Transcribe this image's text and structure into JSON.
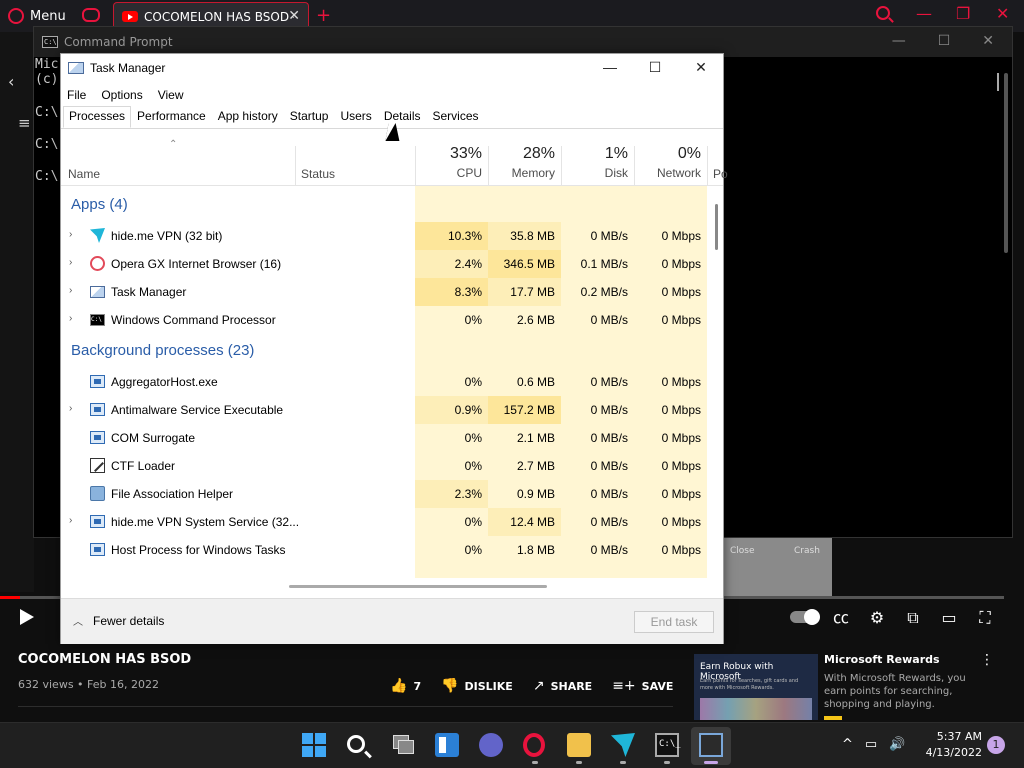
{
  "browser": {
    "menu_label": "Menu",
    "tab_title": "COCOMELON HAS BSOD -",
    "tab_close": "✕",
    "new_tab": "+",
    "minimize": "—",
    "restore": "❐",
    "close": "✕"
  },
  "cmd": {
    "title": "Command Prompt",
    "icon_text": "C:\\",
    "lines": [
      "Mic",
      "(c)",
      "C:\\",
      "C:\\",
      "C:\\"
    ],
    "minimize": "—",
    "maximize": "☐",
    "close": "✕"
  },
  "task_manager": {
    "title": "Task Manager",
    "minimize": "—",
    "maximize": "☐",
    "close": "✕",
    "menus": [
      "File",
      "Options",
      "View"
    ],
    "tabs": [
      "Processes",
      "Performance",
      "App history",
      "Startup",
      "Users",
      "Details",
      "Services"
    ],
    "active_tab": "Processes",
    "columns": {
      "name": "Name",
      "status": "Status",
      "cpu": {
        "pct": "33%",
        "label": "CPU"
      },
      "memory": {
        "pct": "28%",
        "label": "Memory"
      },
      "disk": {
        "pct": "1%",
        "label": "Disk"
      },
      "network": {
        "pct": "0%",
        "label": "Network"
      },
      "cut": "Po"
    },
    "groups": [
      {
        "label": "Apps (4)",
        "rows": [
          {
            "name": "hide.me VPN (32 bit)",
            "icon": "hideme-vpn-icon",
            "expand": true,
            "cpu": "10.3%",
            "memory": "35.8 MB",
            "disk": "0 MB/s",
            "network": "0 Mbps"
          },
          {
            "name": "Opera GX Internet Browser (16)",
            "icon": "opera-gx-icon",
            "expand": true,
            "cpu": "2.4%",
            "memory": "346.5 MB",
            "disk": "0.1 MB/s",
            "network": "0 Mbps"
          },
          {
            "name": "Task Manager",
            "icon": "task-manager-icon",
            "expand": true,
            "cpu": "8.3%",
            "memory": "17.7 MB",
            "disk": "0.2 MB/s",
            "network": "0 Mbps"
          },
          {
            "name": "Windows Command Processor",
            "icon": "cmd-icon",
            "expand": true,
            "cpu": "0%",
            "memory": "2.6 MB",
            "disk": "0 MB/s",
            "network": "0 Mbps"
          }
        ]
      },
      {
        "label": "Background processes (23)",
        "rows": [
          {
            "name": "AggregatorHost.exe",
            "icon": "service-icon",
            "expand": false,
            "cpu": "0%",
            "memory": "0.6 MB",
            "disk": "0 MB/s",
            "network": "0 Mbps"
          },
          {
            "name": "Antimalware Service Executable",
            "icon": "service-icon",
            "expand": true,
            "cpu": "0.9%",
            "memory": "157.2 MB",
            "disk": "0 MB/s",
            "network": "0 Mbps"
          },
          {
            "name": "COM Surrogate",
            "icon": "service-icon",
            "expand": false,
            "cpu": "0%",
            "memory": "2.1 MB",
            "disk": "0 MB/s",
            "network": "0 Mbps"
          },
          {
            "name": "CTF Loader",
            "icon": "ctf-loader-icon",
            "expand": false,
            "cpu": "0%",
            "memory": "2.7 MB",
            "disk": "0 MB/s",
            "network": "0 Mbps"
          },
          {
            "name": "File Association Helper",
            "icon": "file-association-icon",
            "expand": false,
            "cpu": "2.3%",
            "memory": "0.9 MB",
            "disk": "0 MB/s",
            "network": "0 Mbps"
          },
          {
            "name": "hide.me VPN System Service (32...",
            "icon": "service-icon",
            "expand": true,
            "cpu": "0%",
            "memory": "12.4 MB",
            "disk": "0 MB/s",
            "network": "0 Mbps"
          },
          {
            "name": "Host Process for Windows Tasks",
            "icon": "service-icon",
            "expand": false,
            "cpu": "0%",
            "memory": "1.8 MB",
            "disk": "0 MB/s",
            "network": "0 Mbps"
          }
        ]
      }
    ],
    "fewer_details": "Fewer details",
    "end_task": "End task"
  },
  "video": {
    "title": "COCOMELON HAS BSOD",
    "meta": "632 views • Feb 16, 2022",
    "likes": "7",
    "dislike": "DISLIKE",
    "share": "SHARE",
    "save": "SAVE",
    "more": "…",
    "thumb_text_1": "Close",
    "thumb_text_2": "Crash",
    "progress_fraction": 0.02
  },
  "ad": {
    "thumb_title": "Earn Robux with Microsoft",
    "thumb_sub": "Earn points for searches, gift cards and more with Microsoft Rewards.",
    "title": "Microsoft Rewards",
    "description": "With Microsoft Rewards, you earn points for searching, shopping and playing.",
    "more": "⋮"
  },
  "taskbar": {
    "cmd_text": "C:\\_",
    "tray": [
      "^",
      "▭",
      "🔊"
    ],
    "time": "5:37 AM",
    "date": "4/13/2022",
    "notifications": "1"
  },
  "colors": {
    "opera_accent": "#e8133d",
    "tm_group_blue": "#2a5da8",
    "tm_cell_bg": "#fff6d3",
    "tm_cell_hot": "#fde69a",
    "tm_cell_warm": "#fdeeb8"
  }
}
